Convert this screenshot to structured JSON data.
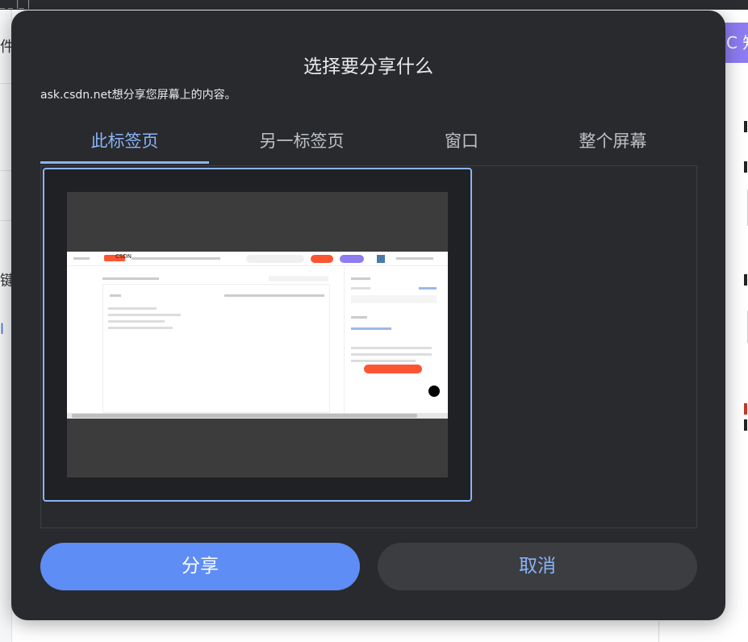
{
  "background": {
    "topbar_text": "_   _ |_       |",
    "left_chars": [
      "件",
      "键",
      "l"
    ],
    "right_button_label": "C 知"
  },
  "dialog": {
    "title": "选择要分享什么",
    "subtitle": "ask.csdn.net想分享您屏幕上的内容。",
    "tabs": [
      {
        "label": "此标签页",
        "active": true
      },
      {
        "label": "另一标签页",
        "active": false
      },
      {
        "label": "窗口",
        "active": false
      },
      {
        "label": "整个屏幕",
        "active": false
      }
    ],
    "preview": {
      "logo_text": "CSDN"
    },
    "share_label": "分享",
    "cancel_label": "取消"
  },
  "colors": {
    "accent": "#8ab4f8",
    "share_button": "#5e8df5",
    "dialog_bg": "#292a2d",
    "cancel_bg": "#3c3d41"
  }
}
